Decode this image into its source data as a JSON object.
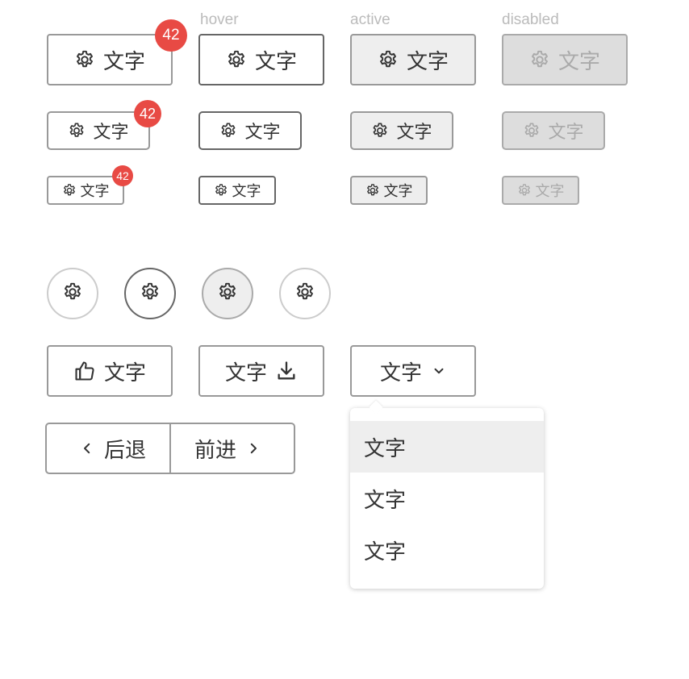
{
  "state_labels": {
    "hover": "hover",
    "active": "active",
    "disabled": "disabled"
  },
  "button_text": "文字",
  "badge_count": "42",
  "icon_names": {
    "gear": "gear-icon",
    "thumbs_up": "thumbs-up-icon",
    "download": "download-icon",
    "chevron_down": "chevron-down-icon",
    "chevron_left": "chevron-left-icon",
    "chevron_right": "chevron-right-icon"
  },
  "action_buttons": {
    "like_label": "文字",
    "download_label": "文字",
    "dropdown_label": "文字"
  },
  "segmented": {
    "back_label": "后退",
    "forward_label": "前进"
  },
  "dropdown_menu": {
    "items": [
      "文字",
      "文字",
      "文字"
    ]
  },
  "colors": {
    "border": "#999999",
    "hover_border": "#666666",
    "active_bg": "#eeeeee",
    "disabled_bg": "#dddddd",
    "badge": "#e84a44"
  }
}
